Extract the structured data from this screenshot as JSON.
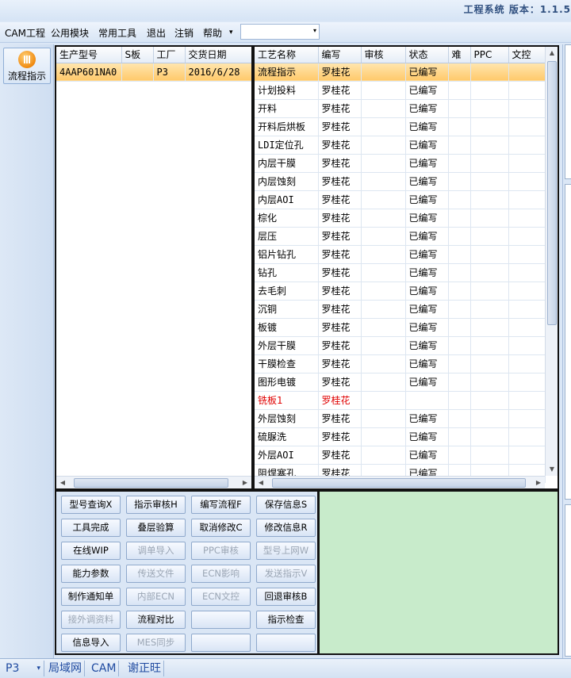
{
  "app": {
    "title": "工程系统 版本：1.1.5"
  },
  "menu": {
    "items": [
      "CAM工程",
      "公用模块",
      "常用工具",
      "退出",
      "注销",
      "帮助"
    ],
    "dropdown_arrow": "▾",
    "combo_value": ""
  },
  "left_rail": {
    "flow_button_label": "流程指示"
  },
  "product_table": {
    "columns": [
      "生产型号",
      "S板",
      "工厂",
      "交货日期"
    ],
    "rows": [
      {
        "model": "4AAP601NA0",
        "s_board": "",
        "factory": "P3",
        "delivery_date": "2016/6/28"
      }
    ]
  },
  "process_table": {
    "columns": [
      "工艺名称",
      "编写",
      "审核",
      "状态",
      "难",
      "PPC",
      "文控"
    ],
    "rows": [
      {
        "name": "流程指示",
        "writer": "罗桂花",
        "reviewer": "",
        "status": "已编写",
        "selected": true
      },
      {
        "name": "计划投料",
        "writer": "罗桂花",
        "reviewer": "",
        "status": "已编写"
      },
      {
        "name": "开料",
        "writer": "罗桂花",
        "reviewer": "",
        "status": "已编写"
      },
      {
        "name": "开料后烘板",
        "writer": "罗桂花",
        "reviewer": "",
        "status": "已编写"
      },
      {
        "name": "LDI定位孔",
        "writer": "罗桂花",
        "reviewer": "",
        "status": "已编写"
      },
      {
        "name": "内层干膜",
        "writer": "罗桂花",
        "reviewer": "",
        "status": "已编写"
      },
      {
        "name": "内层蚀刻",
        "writer": "罗桂花",
        "reviewer": "",
        "status": "已编写"
      },
      {
        "name": "内层AOI",
        "writer": "罗桂花",
        "reviewer": "",
        "status": "已编写"
      },
      {
        "name": "棕化",
        "writer": "罗桂花",
        "reviewer": "",
        "status": "已编写"
      },
      {
        "name": "层压",
        "writer": "罗桂花",
        "reviewer": "",
        "status": "已编写"
      },
      {
        "name": "铝片钻孔",
        "writer": "罗桂花",
        "reviewer": "",
        "status": "已编写"
      },
      {
        "name": "钻孔",
        "writer": "罗桂花",
        "reviewer": "",
        "status": "已编写"
      },
      {
        "name": "去毛刺",
        "writer": "罗桂花",
        "reviewer": "",
        "status": "已编写"
      },
      {
        "name": "沉铜",
        "writer": "罗桂花",
        "reviewer": "",
        "status": "已编写"
      },
      {
        "name": "板镀",
        "writer": "罗桂花",
        "reviewer": "",
        "status": "已编写"
      },
      {
        "name": "外层干膜",
        "writer": "罗桂花",
        "reviewer": "",
        "status": "已编写"
      },
      {
        "name": "干膜检查",
        "writer": "罗桂花",
        "reviewer": "",
        "status": "已编写"
      },
      {
        "name": "图形电镀",
        "writer": "罗桂花",
        "reviewer": "",
        "status": "已编写"
      },
      {
        "name": "铣板1",
        "writer": "罗桂花",
        "reviewer": "",
        "status": "",
        "highlight": "red"
      },
      {
        "name": "外层蚀刻",
        "writer": "罗桂花",
        "reviewer": "",
        "status": "已编写"
      },
      {
        "name": "硫脲洗",
        "writer": "罗桂花",
        "reviewer": "",
        "status": "已编写"
      },
      {
        "name": "外层AOI",
        "writer": "罗桂花",
        "reviewer": "",
        "status": "已编写"
      },
      {
        "name": "阻焊塞孔",
        "writer": "罗桂花",
        "reviewer": "",
        "status": "已编写"
      }
    ]
  },
  "buttons": [
    {
      "label": "型号查询X",
      "enabled": true
    },
    {
      "label": "指示审核H",
      "enabled": true
    },
    {
      "label": "编写流程F",
      "enabled": true
    },
    {
      "label": "保存信息S",
      "enabled": true
    },
    {
      "label": "工具完成",
      "enabled": true
    },
    {
      "label": "叠层验算",
      "enabled": true
    },
    {
      "label": "取消修改C",
      "enabled": true
    },
    {
      "label": "修改信息R",
      "enabled": true
    },
    {
      "label": "在线WIP",
      "enabled": true
    },
    {
      "label": "调单导入",
      "enabled": false
    },
    {
      "label": "PPC审核",
      "enabled": false
    },
    {
      "label": "型号上网W",
      "enabled": false
    },
    {
      "label": "能力参数",
      "enabled": true
    },
    {
      "label": "传送文件",
      "enabled": false
    },
    {
      "label": "ECN影响",
      "enabled": false
    },
    {
      "label": "发送指示V",
      "enabled": false
    },
    {
      "label": "制作通知单",
      "enabled": true
    },
    {
      "label": "内部ECN",
      "enabled": false
    },
    {
      "label": "ECN文控",
      "enabled": false
    },
    {
      "label": "回退审核B",
      "enabled": true
    },
    {
      "label": "接外调资料",
      "enabled": false
    },
    {
      "label": "流程对比",
      "enabled": true
    },
    {
      "label": "",
      "enabled": true
    },
    {
      "label": "指示检查",
      "enabled": true
    },
    {
      "label": "信息导入",
      "enabled": true
    },
    {
      "label": "MES同步",
      "enabled": false
    },
    {
      "label": "",
      "enabled": true
    },
    {
      "label": "",
      "enabled": true
    }
  ],
  "status_bar": {
    "factory": "P3",
    "dropdown_arrow": "▾",
    "network": "局域网",
    "module": "CAM",
    "user": "谢正旺"
  },
  "colors": {
    "selection": "#ffc96b",
    "red_text": "#e00000",
    "green_panel": "#c8ebcb",
    "status_text": "#1f4aa0"
  }
}
